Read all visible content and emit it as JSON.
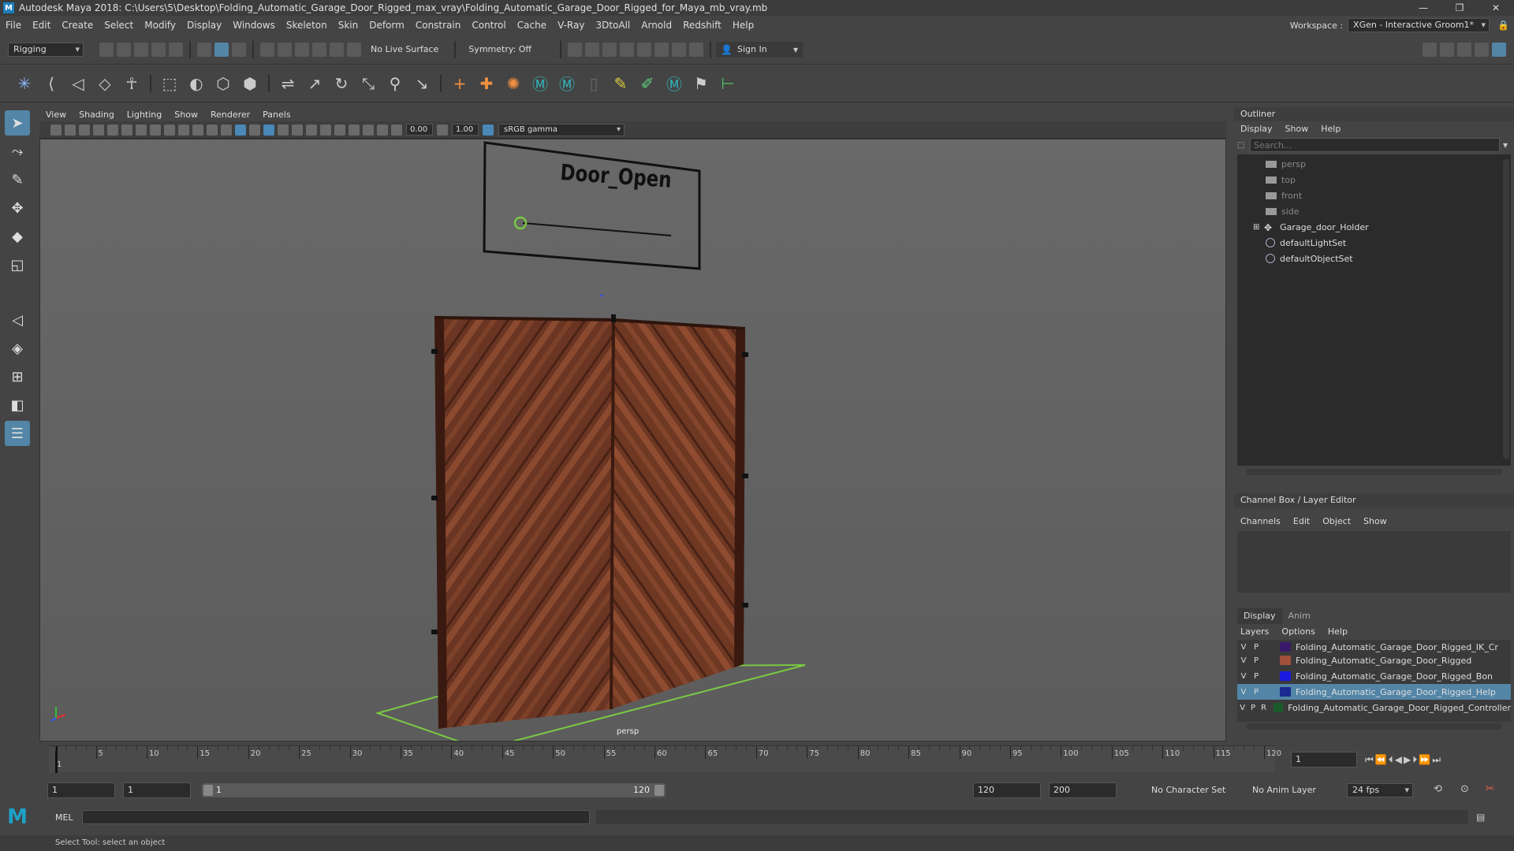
{
  "title": "Autodesk Maya 2018: C:\\Users\\5\\Desktop\\Folding_Automatic_Garage_Door_Rigged_max_vray\\Folding_Automatic_Garage_Door_Rigged_for_Maya_mb_vray.mb",
  "window_buttons": [
    "—",
    "❐",
    "✕"
  ],
  "menu": [
    "File",
    "Edit",
    "Create",
    "Select",
    "Modify",
    "Display",
    "Windows",
    "Skeleton",
    "Skin",
    "Deform",
    "Constrain",
    "Control",
    "Cache",
    "V-Ray",
    "3DtoAll",
    "Arnold",
    "Redshift",
    "Help"
  ],
  "workspace": {
    "label": "Workspace :",
    "value": "XGen - Interactive Groom1*"
  },
  "status": {
    "mode": "Rigging",
    "live_surface": "No Live Surface",
    "symmetry": "Symmetry: Off",
    "sign_in": "Sign In"
  },
  "viewport": {
    "menu": [
      "View",
      "Shading",
      "Lighting",
      "Show",
      "Renderer",
      "Panels"
    ],
    "exposure": "0.00",
    "gamma": "1.00",
    "color_space": "sRGB gamma",
    "camera_label": "persp",
    "controller_text": "Door_Open"
  },
  "outliner": {
    "title": "Outliner",
    "menu": [
      "Display",
      "Show",
      "Help"
    ],
    "search_placeholder": "Search...",
    "items": [
      {
        "name": "persp",
        "type": "camera",
        "dim": true
      },
      {
        "name": "top",
        "type": "camera",
        "dim": true
      },
      {
        "name": "front",
        "type": "camera",
        "dim": true
      },
      {
        "name": "side",
        "type": "camera",
        "dim": true
      },
      {
        "name": "Garage_door_Holder",
        "type": "transform",
        "dim": false
      },
      {
        "name": "defaultLightSet",
        "type": "set",
        "dim": false
      },
      {
        "name": "defaultObjectSet",
        "type": "set",
        "dim": false
      }
    ]
  },
  "channel_box": {
    "title": "Channel Box / Layer Editor",
    "menu": [
      "Channels",
      "Edit",
      "Object",
      "Show"
    ]
  },
  "layer_editor": {
    "tabs": [
      "Display",
      "Anim"
    ],
    "menu": [
      "Layers",
      "Options",
      "Help"
    ],
    "layers": [
      {
        "v": "V",
        "p": "P",
        "r": "",
        "color": "#3a1a6a",
        "name": "Folding_Automatic_Garage_Door_Rigged_IK_Cr",
        "selected": false
      },
      {
        "v": "V",
        "p": "P",
        "r": "",
        "color": "#a0503a",
        "name": "Folding_Automatic_Garage_Door_Rigged",
        "selected": false
      },
      {
        "v": "V",
        "p": "P",
        "r": "",
        "color": "#1a1ae0",
        "name": "Folding_Automatic_Garage_Door_Rigged_Bon",
        "selected": false
      },
      {
        "v": "V",
        "p": "P",
        "r": "",
        "color": "#1a2a90",
        "name": "Folding_Automatic_Garage_Door_Rigged_Help",
        "selected": true
      },
      {
        "v": "V",
        "p": "P",
        "r": "R",
        "color": "#1a5a2a",
        "name": "Folding_Automatic_Garage_Door_Rigged_Controller",
        "selected": false
      }
    ]
  },
  "timeline": {
    "ticks": [
      "5",
      "10",
      "15",
      "20",
      "25",
      "30",
      "35",
      "40",
      "45",
      "50",
      "55",
      "60",
      "65",
      "70",
      "75",
      "80",
      "85",
      "90",
      "95",
      "100",
      "105",
      "110",
      "115",
      "120"
    ],
    "start_marker": "1",
    "current_frame": "1"
  },
  "range": {
    "start": "1",
    "anim_start": "1",
    "slider_start": "1",
    "slider_end": "120",
    "end": "120",
    "anim_end": "200",
    "character_set": "No Character Set",
    "anim_layer": "No Anim Layer",
    "fps": "24 fps"
  },
  "command": {
    "label": "MEL",
    "help": "Select Tool: select an object"
  }
}
